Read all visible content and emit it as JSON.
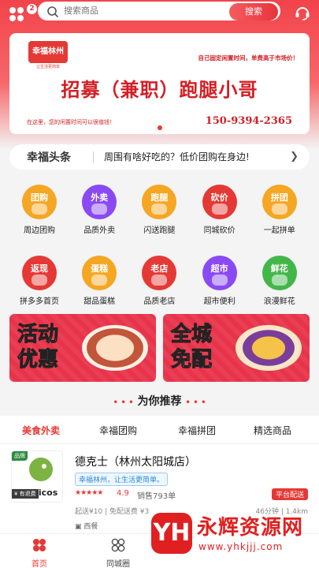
{
  "header": {
    "menu_badge": "2",
    "search_placeholder": "搜索商品",
    "search_button": "搜索"
  },
  "banner": {
    "logo_text": "幸福林州",
    "logo_sub": "让生活更简单",
    "note": "自己固定闲置时间，单费高于市场价！",
    "title": "招募（兼职）跑腿小哥",
    "subtitle": "在这里，您的闲置时间可以很值钱！",
    "phone": "150-9394-2365"
  },
  "news": {
    "label": "幸福头条",
    "text": "周围有啥好吃的？低价团购在身边!"
  },
  "categories": [
    {
      "tag": "团购",
      "label": "周边团购",
      "color": "#f5a623"
    },
    {
      "tag": "外卖",
      "label": "品质外卖",
      "color": "#8a4af3"
    },
    {
      "tag": "跑腿",
      "label": "闪送跑腿",
      "color": "#f5a623"
    },
    {
      "tag": "砍价",
      "label": "同城砍价",
      "color": "#e53935"
    },
    {
      "tag": "拼团",
      "label": "一起拼单",
      "color": "#f5a623"
    },
    {
      "tag": "返现",
      "label": "拼多多首页",
      "color": "#e53935"
    },
    {
      "tag": "蛋糕",
      "label": "甜品蛋糕",
      "color": "#f5a623"
    },
    {
      "tag": "老店",
      "label": "品质老店",
      "color": "#e53935"
    },
    {
      "tag": "超市",
      "label": "超市便利",
      "color": "#8a4af3"
    },
    {
      "tag": "鲜花",
      "label": "浪漫鲜花",
      "color": "#43b649"
    }
  ],
  "promos": [
    {
      "text": "活动优惠"
    },
    {
      "text": "全城免配"
    }
  ],
  "recommend": {
    "title": "为你推荐",
    "tabs": [
      "美食外卖",
      "幸福团购",
      "幸福拼团",
      "精选商品"
    ]
  },
  "store": {
    "brand_tag": "品牌",
    "brand_name": "dicos",
    "refund": "¥ 有退费",
    "name": "德克士（林州太阳城店）",
    "slogan": "幸福林州，让生活更简单。",
    "stars": "★★★★★",
    "rating": "4.9",
    "sales": "销售793单",
    "platform": "平台配送",
    "delivery": "起送¥10 | 免配送费 ¥3",
    "eta": "46分钟 | 1.4km",
    "category": "西餐"
  },
  "nav": {
    "home": "首页",
    "circle": "同城圈"
  },
  "watermark": {
    "logo": "YH",
    "title": "永辉资源网",
    "url": "www.yhkjjj.com"
  }
}
